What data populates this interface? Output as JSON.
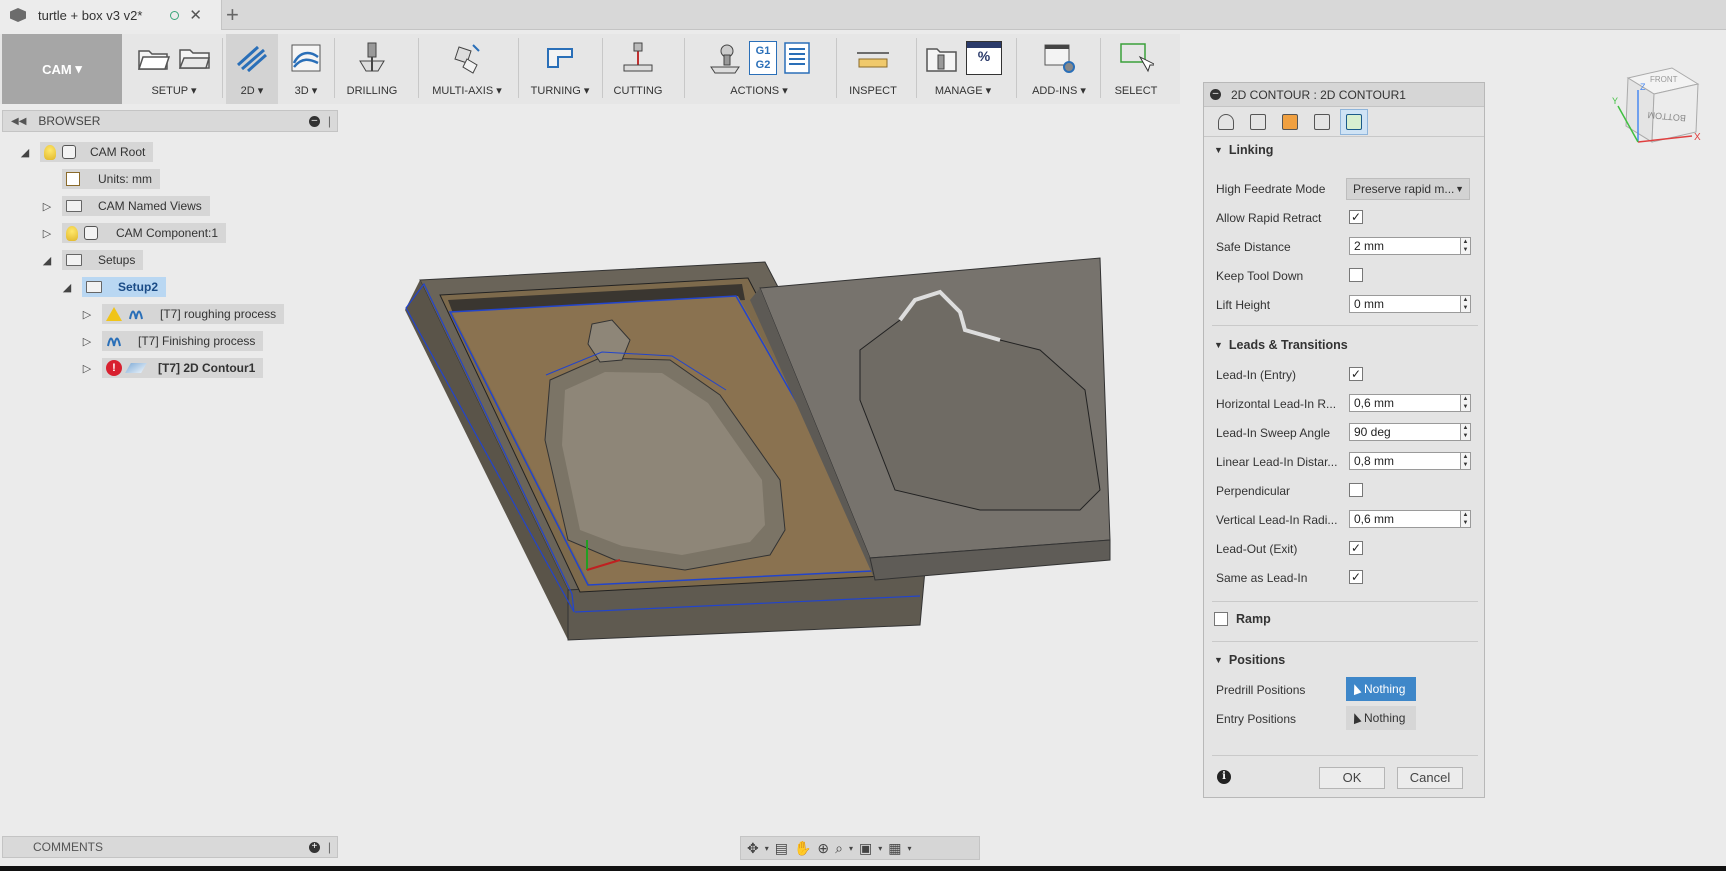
{
  "document": {
    "title": "turtle + box v3 v2*"
  },
  "workspace": {
    "label": "CAM",
    "caret": "▾"
  },
  "toolbar": {
    "groups": [
      {
        "label": "SETUP ▾"
      },
      {
        "label": "2D ▾"
      },
      {
        "label": "3D ▾"
      },
      {
        "label": "DRILLING"
      },
      {
        "label": "MULTI-AXIS ▾"
      },
      {
        "label": "TURNING ▾"
      },
      {
        "label": "CUTTING"
      },
      {
        "label": "ACTIONS ▾"
      },
      {
        "label": "INSPECT"
      },
      {
        "label": "MANAGE ▾"
      },
      {
        "label": "ADD-INS ▾"
      },
      {
        "label": "SELECT"
      }
    ],
    "g1g2": {
      "l1": "G1",
      "l2": "G2"
    },
    "percent": "%"
  },
  "browser": {
    "title": "BROWSER",
    "items": [
      {
        "label": "CAM Root"
      },
      {
        "label": "Units: mm"
      },
      {
        "label": "CAM Named Views"
      },
      {
        "label": "CAM Component:1"
      },
      {
        "label": "Setups"
      },
      {
        "label": "Setup2"
      },
      {
        "label": "[T7] roughing process"
      },
      {
        "label": "[T7] Finishing process"
      },
      {
        "label": "[T7] 2D Contour1"
      }
    ]
  },
  "comments": {
    "title": "COMMENTS"
  },
  "viewcube": {
    "front": "FRONT",
    "bottom": "BOTTOM",
    "x": "X",
    "y": "Y",
    "z": "Z"
  },
  "dialog": {
    "title": "2D CONTOUR : 2D CONTOUR1",
    "sections": {
      "linking": "Linking",
      "leads": "Leads & Transitions",
      "ramp": "Ramp",
      "positions": "Positions"
    },
    "fields": {
      "high_feedrate_mode": {
        "label": "High Feedrate Mode",
        "value": "Preserve rapid m..."
      },
      "allow_rapid_retract": {
        "label": "Allow Rapid Retract",
        "checked": "✓"
      },
      "safe_distance": {
        "label": "Safe Distance",
        "value": "2 mm"
      },
      "keep_tool_down": {
        "label": "Keep Tool Down",
        "checked": ""
      },
      "lift_height": {
        "label": "Lift Height",
        "value": "0 mm"
      },
      "lead_in_entry": {
        "label": "Lead-In (Entry)",
        "checked": "✓"
      },
      "horizontal_lead_in_radius": {
        "label": "Horizontal Lead-In R...",
        "value": "0,6 mm"
      },
      "lead_in_sweep_angle": {
        "label": "Lead-In Sweep Angle",
        "value": "90 deg"
      },
      "linear_lead_in_distance": {
        "label": "Linear Lead-In Distar...",
        "value": "0,8 mm"
      },
      "perpendicular": {
        "label": "Perpendicular",
        "checked": ""
      },
      "vertical_lead_in_radius": {
        "label": "Vertical Lead-In Radi...",
        "value": "0,6 mm"
      },
      "lead_out_exit": {
        "label": "Lead-Out (Exit)",
        "checked": "✓"
      },
      "same_as_lead_in": {
        "label": "Same as Lead-In",
        "checked": "✓"
      },
      "ramp": {
        "checked": ""
      },
      "predrill_positions": {
        "label": "Predrill Positions",
        "value": "Nothing"
      },
      "entry_positions": {
        "label": "Entry Positions",
        "value": "Nothing"
      }
    },
    "ok": "OK",
    "cancel": "Cancel",
    "info": "i"
  },
  "colors": {
    "accent": "#3e87c9",
    "selected": "#b9d7f2",
    "error": "#d8202f",
    "warning": "#f0c419"
  }
}
